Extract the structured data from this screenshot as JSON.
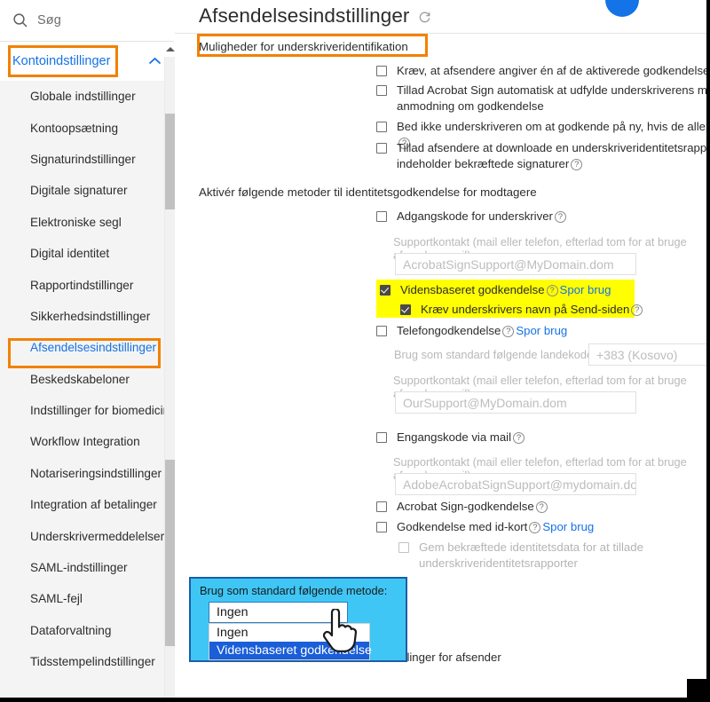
{
  "search": {
    "placeholder": "Søg",
    "icon": "search-icon"
  },
  "sidebar": {
    "account_header": {
      "label": "Kontoindstillinger",
      "icon": "chevron-up-icon"
    },
    "items": [
      {
        "label": "Globale indstillinger",
        "selected": false
      },
      {
        "label": "Kontoopsætning",
        "selected": false
      },
      {
        "label": "Signaturindstillinger",
        "selected": false
      },
      {
        "label": "Digitale signaturer",
        "selected": false
      },
      {
        "label": "Elektroniske segl",
        "selected": false
      },
      {
        "label": "Digital identitet",
        "selected": false
      },
      {
        "label": "Rapportindstillinger",
        "selected": false
      },
      {
        "label": "Sikkerhedsindstillinger",
        "selected": false
      },
      {
        "label": "Afsendelsesindstillinger",
        "selected": true
      },
      {
        "label": "Beskedskabeloner",
        "selected": false
      },
      {
        "label": "Indstillinger for biomedicin",
        "selected": false
      },
      {
        "label": "Workflow Integration",
        "selected": false
      },
      {
        "label": "Notariseringsindstillinger",
        "selected": false
      },
      {
        "label": "Integration af betalinger",
        "selected": false
      },
      {
        "label": "Underskrivermeddelelser",
        "selected": false
      },
      {
        "label": "SAML-indstillinger",
        "selected": false
      },
      {
        "label": "SAML-fejl",
        "selected": false
      },
      {
        "label": "Dataforvaltning",
        "selected": false
      },
      {
        "label": "Tidsstempelindstillinger",
        "selected": false
      }
    ],
    "scroll_arrow_icon": "triangle-up-icon"
  },
  "header": {
    "title": "Afsendelsesindstillinger",
    "refresh_icon": "refresh-icon",
    "avatar": "avatar"
  },
  "main": {
    "section_signer_identification": "Muligheder for underskriveridentifikation",
    "options": [
      {
        "label": "Kræv, at afsendere angiver én af de aktiverede godkendelsesmetoder for modtagere",
        "checked": false,
        "help": false
      },
      {
        "label": "Tillad Acrobat Sign automatisk at udfylde underskriverens mailadresse for hver anmodning om godkendelse",
        "checked": false,
        "help": false
      },
      {
        "label": "Bed ikke underskriveren om at godkende på ny, hvis de allerede er logget på Acrobat Sign",
        "checked": false,
        "help": true
      },
      {
        "label": "Tillad afsendere at downloade en underskriveridentitetsrapport for aftaler, der indeholder bekræftede signaturer",
        "checked": false,
        "help": true
      }
    ],
    "section_enable_methods": "Aktivér følgende metoder til identitetsgodkendelse for modtagere",
    "methods": {
      "password": {
        "label": "Adgangskode for underskriver",
        "checked": false,
        "support_label": "Supportkontakt (mail eller telefon, efterlad tom for at bruge afsenders mail):",
        "support_value": "AcrobatSignSupport@MyDomain.dom"
      },
      "kba": {
        "label": "Vidensbaseret godkendelse",
        "checked": true,
        "track_link": "Spor brug",
        "child": {
          "label": "Kræv underskrivers navn på Send-siden",
          "checked": true
        }
      },
      "phone": {
        "label": "Telefongodkendelse",
        "checked": false,
        "track_link": "Spor brug",
        "country_label": "Brug som standard følgende landekode:",
        "country_value": "+383 (Kosovo)",
        "support_label": "Supportkontakt (mail eller telefon, efterlad tom for at bruge afsenders mail):",
        "support_value": "OurSupport@MyDomain.dom"
      },
      "otp_mail": {
        "label": "Engangskode via mail",
        "checked": false,
        "support_label": "Supportkontakt (mail eller telefon, efterlad tom for at bruge afsenders mail):",
        "support_value": "AdobeAcrobatSignSupport@mydomain.dor"
      },
      "acrobat_sign": {
        "label": "Acrobat Sign-godkendelse",
        "checked": false
      },
      "id_card": {
        "label": "Godkendelse med id-kort",
        "checked": false,
        "track_link": "Spor brug",
        "child": {
          "label": "Gem bekræftede identitetsdata for at tillade underskriveridentitetsrapporter",
          "checked": false,
          "disabled": true
        }
      }
    },
    "default_method": {
      "label": "Brug som standard følgende metode:",
      "selected": "Ingen",
      "options": [
        {
          "label": "Ingen",
          "highlighted": false
        },
        {
          "label": "Vidensbaseret godkendelse",
          "highlighted": true
        }
      ]
    },
    "behind_text": "Indstillinger for afsender"
  },
  "colors": {
    "accent_blue": "#1473e6",
    "highlight_orange": "#f28100",
    "highlight_yellow": "#ffff00",
    "callout_cyan": "#3fc6f4",
    "option_selected_blue": "#1a5ed8"
  }
}
